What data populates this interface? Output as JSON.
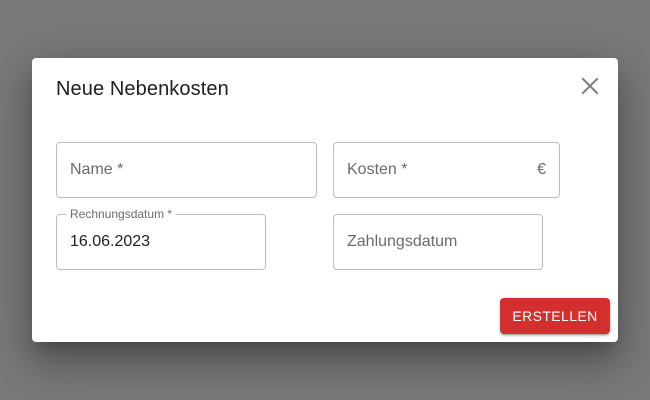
{
  "dialog": {
    "title": "Neue Nebenkosten",
    "close_icon": "close-icon",
    "fields": {
      "name": {
        "placeholder": "Name *",
        "value": ""
      },
      "cost": {
        "placeholder": "Kosten *",
        "value": "",
        "adornment": "€"
      },
      "invoice_date": {
        "label": "Rechnungsdatum *",
        "value": "16.06.2023"
      },
      "payment_date": {
        "placeholder": "Zahlungsdatum",
        "value": ""
      }
    },
    "submit_label": "ERSTELLEN"
  },
  "colors": {
    "backdrop": "#7a7a7a",
    "surface": "#ffffff",
    "primary_button": "#d32f2f",
    "border": "#bdbdbd"
  }
}
